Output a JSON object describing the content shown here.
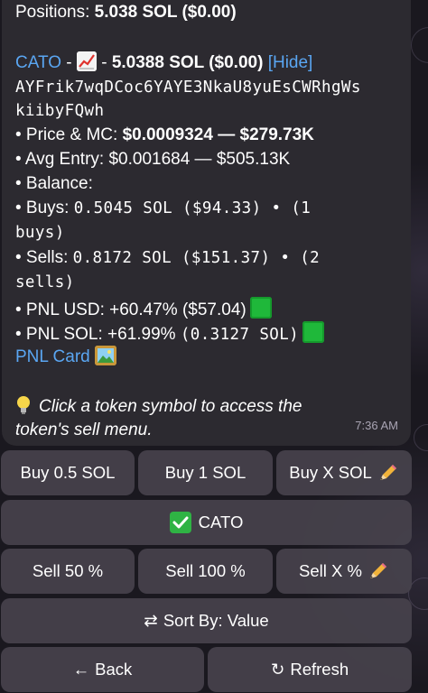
{
  "message": {
    "positions_label": "Positions: ",
    "positions_value": "5.038 SOL ($0.00)",
    "token_symbol": "CATO",
    "token_sep": " - ",
    "token_sep2": " - ",
    "token_amount": "5.0388 SOL ($0.00)",
    "hide_label": "[Hide]",
    "address_line1": "AYFrik7wqDCoc6YAYE3NkaU8yuEsCWRhgWs",
    "address_line2": "kiibyFQwh",
    "price_mc_label": "• Price & MC: ",
    "price_mc_value": "$0.0009324 — $279.73K",
    "avg_entry": "• Avg Entry: $0.001684 — $505.13K",
    "balance": "• Balance:",
    "buys_label": "• Buys: ",
    "buys_value_l1": "0.5045 SOL ($94.33) • (1",
    "buys_value_l2": "buys)",
    "sells_label": "• Sells: ",
    "sells_value_l1": "0.8172 SOL ($151.37) • (2",
    "sells_value_l2": "sells)",
    "pnl_usd_label": "• PNL USD: +60.47% ($57.04)",
    "pnl_sol_label": "• PNL SOL: +61.99% ",
    "pnl_sol_value": "(0.3127 SOL)",
    "pnl_card": "PNL Card",
    "hint_line1": "Click a token symbol to access the",
    "hint_line2": "token's sell menu.",
    "time": "7:36 AM"
  },
  "keyboard": {
    "buy_05": "Buy 0.5 SOL",
    "buy_1": "Buy 1 SOL",
    "buy_x": "Buy X SOL",
    "token": "CATO",
    "sell_50": "Sell 50 %",
    "sell_100": "Sell 100 %",
    "sell_x": "Sell X %",
    "sort_icon": "⇄",
    "sort": "Sort By: Value",
    "back_icon": "←",
    "back": "Back",
    "refresh_icon": "↻",
    "refresh": "Refresh"
  },
  "icons": {
    "chart": "chart-increasing-emoji",
    "picture": "framed-picture-emoji",
    "bulb": "light-bulb-emoji",
    "pencil": "pencil-emoji",
    "check": "check-mark-button-emoji",
    "pnl_green": "green-square-emoji"
  },
  "colors": {
    "link": "#5aa6f2",
    "bubble": "#2c2a30",
    "button": "#46424c",
    "green": "#1fb83a"
  }
}
